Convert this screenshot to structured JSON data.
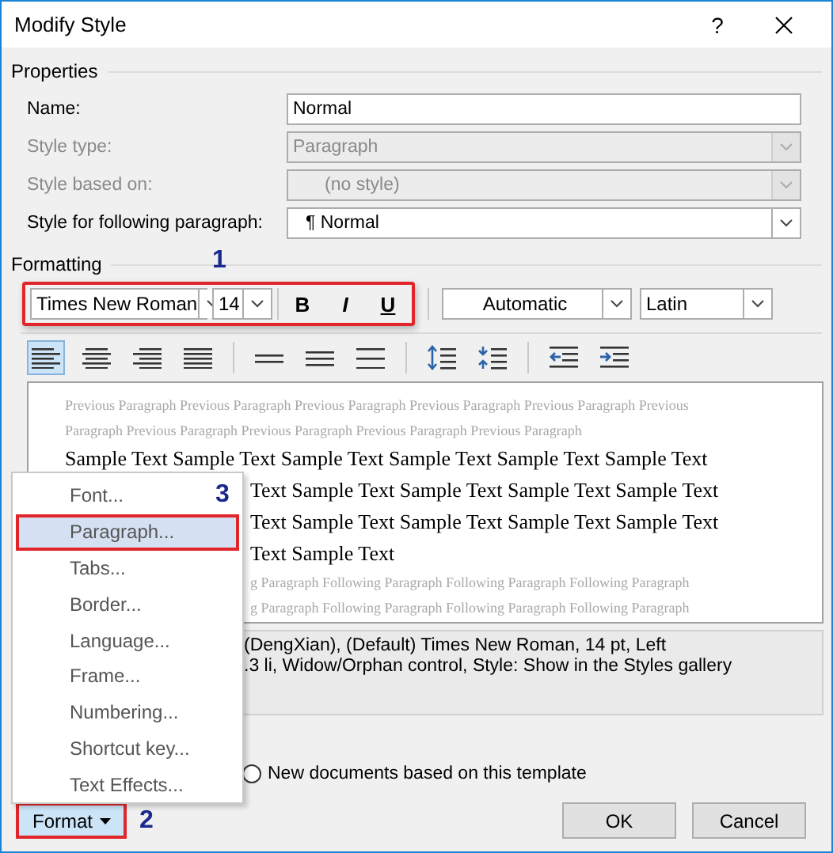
{
  "window": {
    "title": "Modify Style",
    "help": "?"
  },
  "properties": {
    "heading": "Properties",
    "rows": [
      {
        "label": "Name:",
        "value": "Normal",
        "kind": "text",
        "disabled": false
      },
      {
        "label": "Style type:",
        "value": "Paragraph",
        "kind": "combo",
        "disabled": true
      },
      {
        "label": "Style based on:",
        "value": "(no style)",
        "kind": "combo",
        "disabled": true
      },
      {
        "label": "Style for following paragraph:",
        "value": "Normal",
        "prefix": "¶",
        "kind": "combo",
        "disabled": false
      }
    ]
  },
  "formatting": {
    "heading": "Formatting",
    "font": "Times New Roman",
    "size": "14",
    "bold": "B",
    "italic": "I",
    "underline": "U",
    "font_color": "Automatic",
    "script": "Latin",
    "alignment_buttons": [
      {
        "selected": true
      },
      {
        "selected": false
      },
      {
        "selected": false
      },
      {
        "selected": false
      }
    ]
  },
  "preview": {
    "lines": [
      {
        "kind": "previous",
        "text": "Previous Paragraph Previous Paragraph Previous Paragraph Previous Paragraph Previous Paragraph Previous"
      },
      {
        "kind": "previous",
        "text": "Paragraph Previous Paragraph Previous Paragraph Previous Paragraph Previous Paragraph"
      },
      {
        "kind": "sample",
        "text": "Sample Text Sample Text Sample Text Sample Text Sample Text Sample Text"
      },
      {
        "kind": "sample_cut",
        "text": "Text Sample Text Sample Text Sample Text Sample Text"
      },
      {
        "kind": "sample_cut",
        "text": "Text Sample Text Sample Text Sample Text Sample Text"
      },
      {
        "kind": "sample_cut",
        "text": "Text Sample Text"
      },
      {
        "kind": "following_cut",
        "text": "g Paragraph Following Paragraph Following Paragraph Following Paragraph"
      },
      {
        "kind": "following_cut",
        "text": "g Paragraph Following Paragraph Following Paragraph Following Paragraph"
      }
    ]
  },
  "description": {
    "lines": [
      "(DengXian), (Default) Times New Roman, 14 pt, Left",
      ".3 li, Widow/Orphan control, Style: Show in the Styles gallery"
    ]
  },
  "radio": {
    "label": "New documents based on this template",
    "selected": false
  },
  "format_menu": {
    "button": "Format",
    "items": [
      {
        "label": "Font...",
        "selected": false
      },
      {
        "label": "Paragraph...",
        "selected": true
      },
      {
        "label": "Tabs...",
        "selected": false
      },
      {
        "label": "Border...",
        "selected": false
      },
      {
        "label": "Language...",
        "selected": false
      },
      {
        "label": "Frame...",
        "selected": false
      },
      {
        "label": "Numbering...",
        "selected": false
      },
      {
        "label": "Shortcut key...",
        "selected": false
      },
      {
        "label": "Text Effects...",
        "selected": false
      }
    ]
  },
  "buttons": [
    "OK",
    "Cancel"
  ],
  "annotations": [
    "1",
    "2",
    "3"
  ]
}
